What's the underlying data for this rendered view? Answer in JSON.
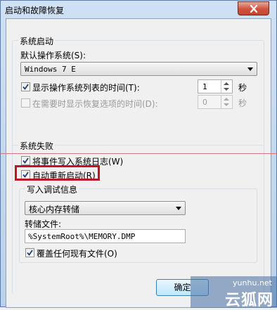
{
  "window": {
    "title": "启动和故障恢复"
  },
  "system_startup": {
    "group_title": "系统启动",
    "default_os_label": "默认操作系统(S):",
    "default_os_value": "Windows 7 E",
    "show_list": {
      "checked": true,
      "label": "显示操作系统列表的时间(T):",
      "value": "1",
      "unit": "秒"
    },
    "show_recovery": {
      "checked": false,
      "enabled": false,
      "label": "在需要时显示恢复选项的时间(D):",
      "value": "0",
      "unit": "秒"
    }
  },
  "system_failure": {
    "group_title": "系统失败",
    "write_event": {
      "checked": true,
      "label": "将事件写入系统日志(W)"
    },
    "auto_restart": {
      "checked": true,
      "label": "自动重新启动(R)"
    },
    "debug_info": {
      "group_title": "写入调试信息",
      "dump_type": "核心内存转储",
      "dump_file_label": "转储文件:",
      "dump_file_value": "%SystemRoot%\\MEMORY.DMP",
      "overwrite": {
        "checked": true,
        "label": "覆盖任何现有文件(O)"
      }
    }
  },
  "buttons": {
    "ok_label": "确定"
  },
  "watermark": {
    "url": "yunhu.net",
    "logo_text": "云狐网"
  },
  "colors": {
    "highlight": "#c0141e",
    "close_button": "#d0523d"
  }
}
